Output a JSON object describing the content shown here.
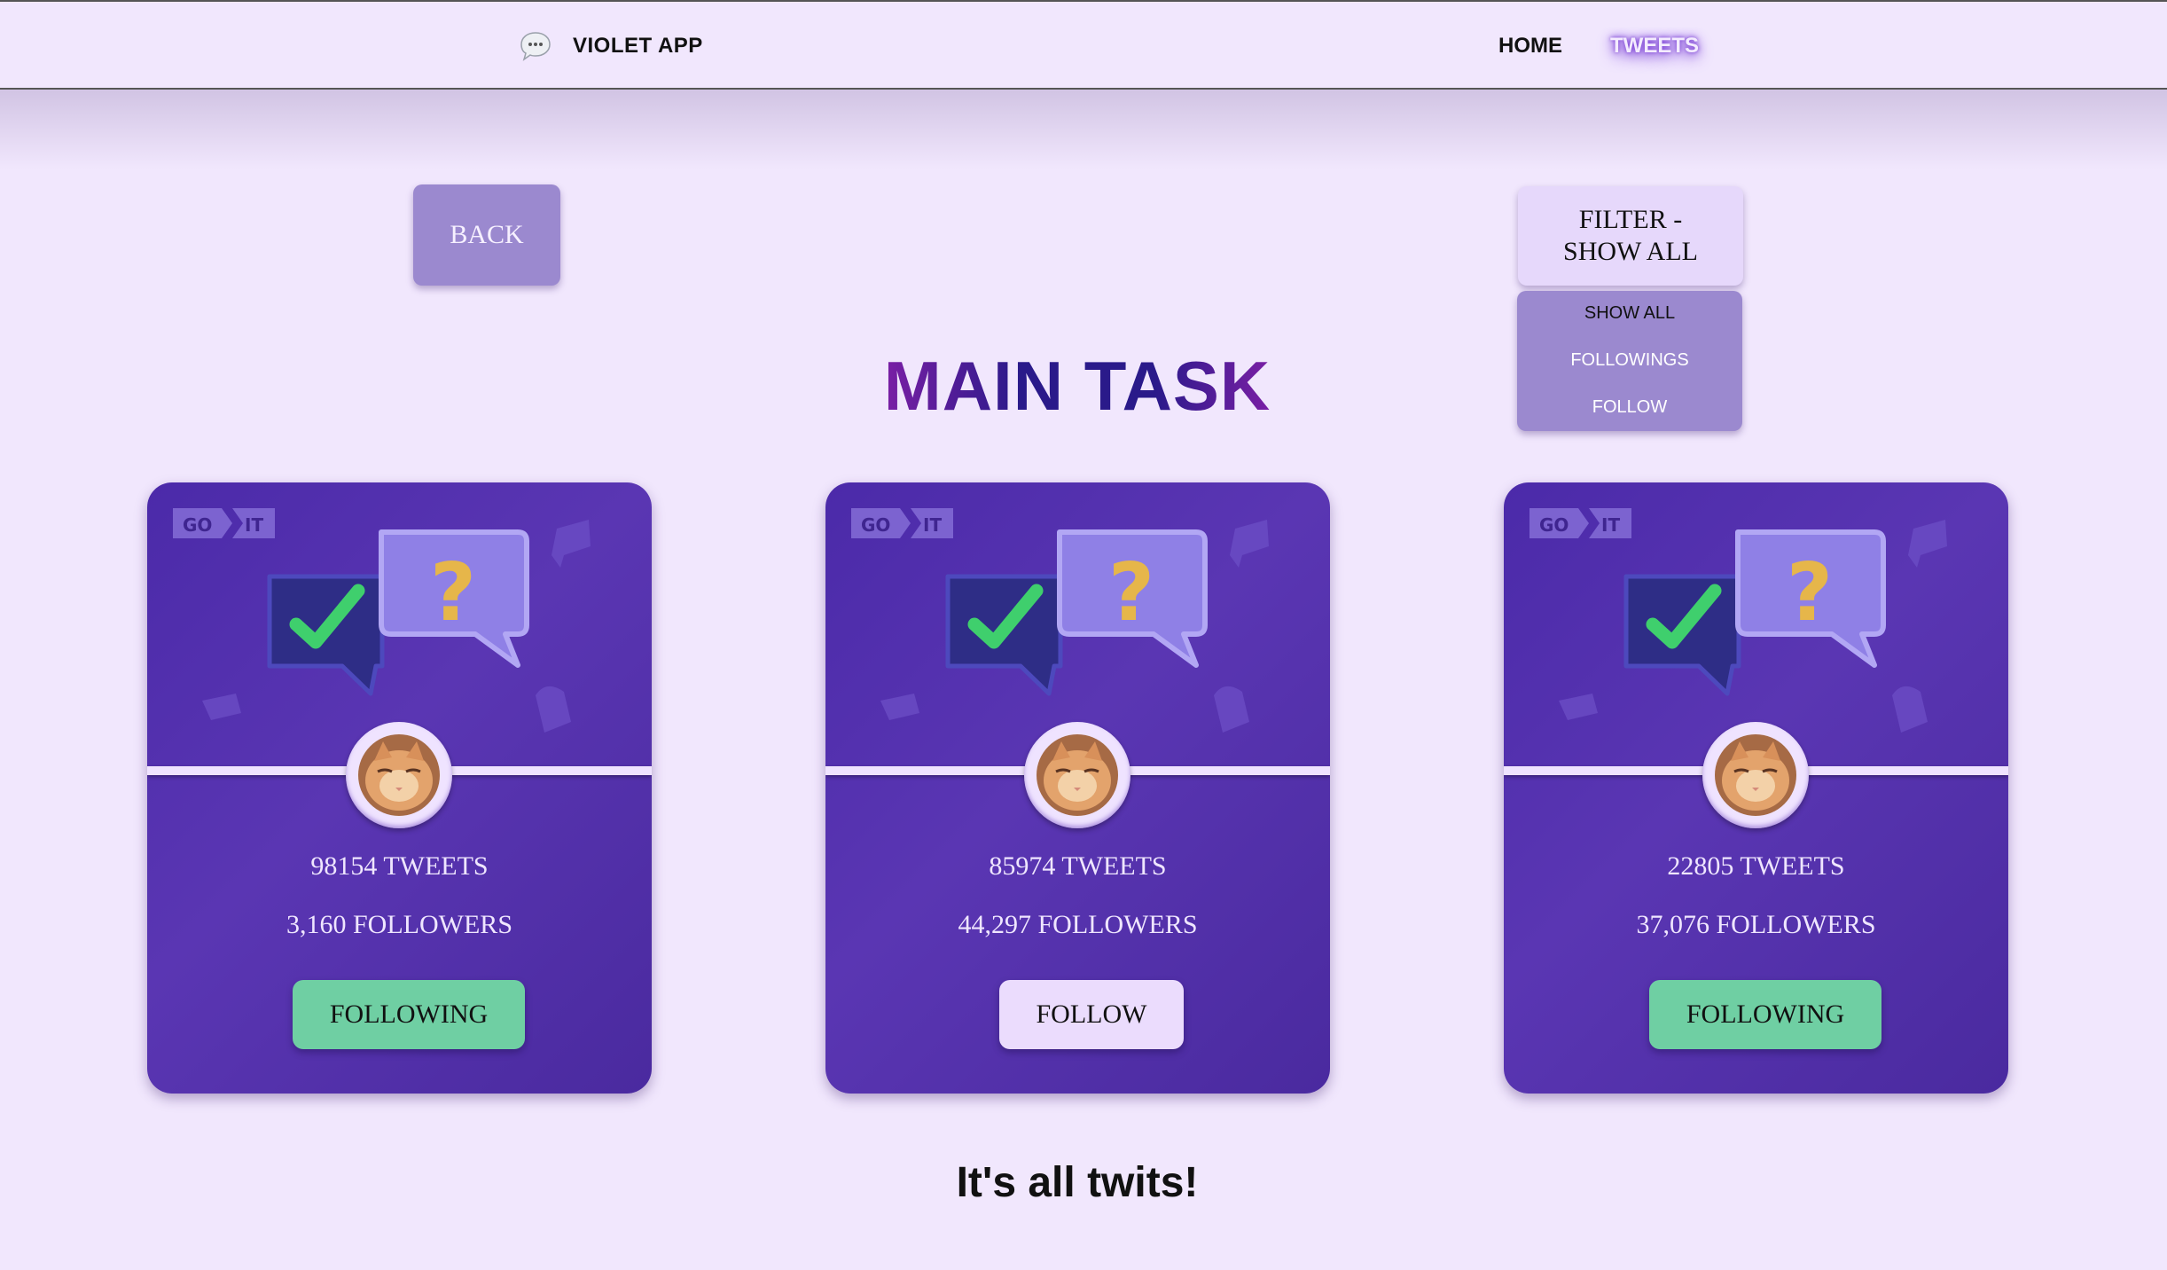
{
  "header": {
    "logo_text": "VIOLET APP",
    "nav": {
      "home": "HOME",
      "tweets": "TWEETS"
    }
  },
  "back_button": "BACK",
  "filter": {
    "button_line1": "FILTER -",
    "button_line2": "SHOW ALL",
    "options": [
      "SHOW ALL",
      "FOLLOWINGS",
      "FOLLOW"
    ],
    "selected": "SHOW ALL"
  },
  "page_title": "MAIN TASK",
  "card_logo": {
    "left": "GO",
    "right": "IT"
  },
  "cards": [
    {
      "tweets": "98154 TWEETS",
      "followers": "3,160 FOLLOWERS",
      "button": "FOLLOWING",
      "state": "following"
    },
    {
      "tweets": "85974 TWEETS",
      "followers": "44,297 FOLLOWERS",
      "button": "FOLLOW",
      "state": "follow"
    },
    {
      "tweets": "22805 TWEETS",
      "followers": "37,076 FOLLOWERS",
      "button": "FOLLOWING",
      "state": "following"
    }
  ],
  "footer_text": "It's all twits!",
  "colors": {
    "background": "#f1e7fd",
    "card": "#4b2aa9",
    "following_button": "#6fcfa3",
    "follow_button": "#ebdcfd",
    "filter_menu": "#9b89cf"
  }
}
